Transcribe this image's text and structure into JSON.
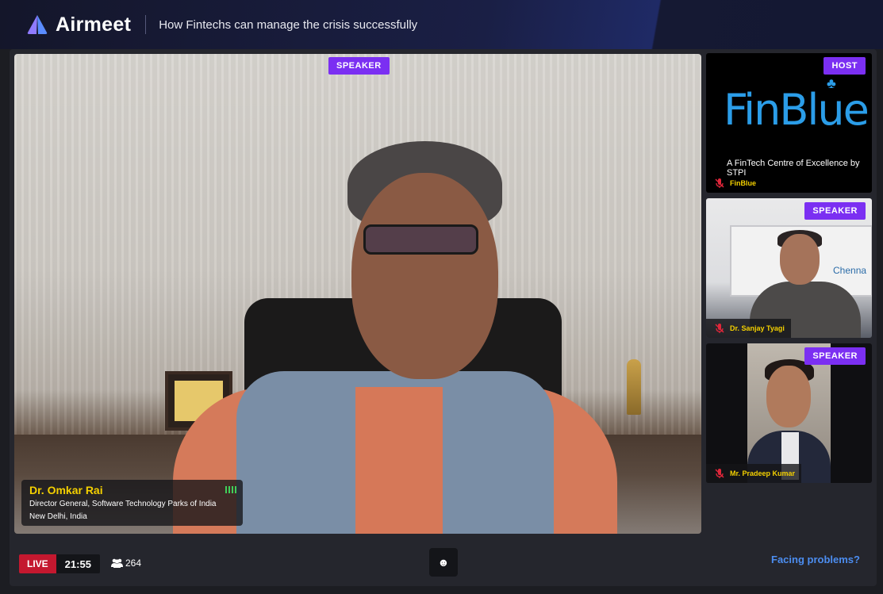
{
  "app": {
    "name": "Airmeet",
    "event_title": "How Fintechs can manage the crisis successfully"
  },
  "main_stage": {
    "role_badge": "SPEAKER",
    "speaker": {
      "name": "Dr. Omkar Rai",
      "title": "Director General, Software Technology Parks of India",
      "location": "New Delhi, India"
    }
  },
  "side_tiles": [
    {
      "role_badge": "HOST",
      "name": "FinBlue",
      "logo_text": "FinBlue",
      "tagline": "A FinTech Centre of Excellence by STPI"
    },
    {
      "role_badge": "SPEAKER",
      "name": "Dr. Sanjay Tyagi",
      "background_text": "Chenna"
    },
    {
      "role_badge": "SPEAKER",
      "name": "Mr. Pradeep Kumar"
    }
  ],
  "footer": {
    "live_label": "LIVE",
    "elapsed": "21:55",
    "attendee_count": "264",
    "reaction_icon": "☻",
    "help_link": "Facing problems?"
  },
  "colors": {
    "accent_purple": "#7b2ff2",
    "live_red": "#c4182f",
    "name_yellow": "#f4d000",
    "link_blue": "#4c8df0",
    "audio_green": "#40d05a"
  }
}
